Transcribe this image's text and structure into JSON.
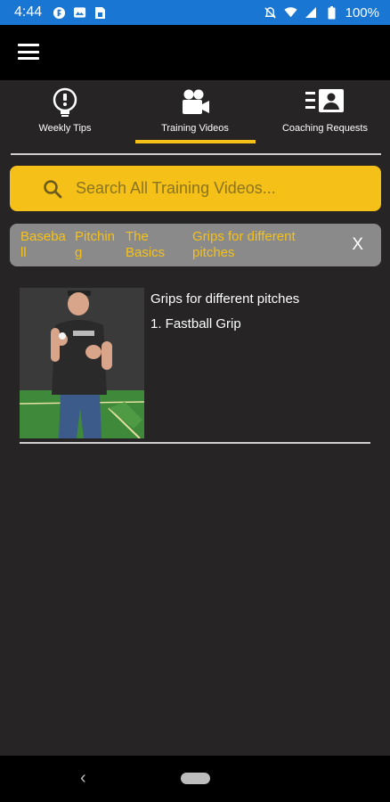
{
  "status_bar": {
    "time": "4:44",
    "battery": "100%",
    "icons_left": [
      "app-notification-icon",
      "photo-icon",
      "sim-icon"
    ],
    "icons_right": [
      "mute-icon",
      "wifi-icon",
      "signal-icon",
      "battery-icon"
    ]
  },
  "app_bar": {
    "menu_icon": "hamburger-menu-icon"
  },
  "tabs": [
    {
      "label": "Weekly Tips",
      "icon": "lightbulb-icon",
      "active": false
    },
    {
      "label": "Training Videos",
      "icon": "video-camera-icon",
      "active": true
    },
    {
      "label": "Coaching Requests",
      "icon": "contact-list-icon",
      "active": false
    }
  ],
  "search": {
    "placeholder": "Search All Training Videos...",
    "value": ""
  },
  "breadcrumb": {
    "items": [
      "Baseball",
      "Pitching",
      "The Basics",
      "Grips for different pitches"
    ],
    "clear_label": "X"
  },
  "videos": [
    {
      "title": "Grips for different pitches",
      "subtitle": "1. Fastball Grip"
    }
  ],
  "nav_bar": {
    "back_label": "‹"
  },
  "colors": {
    "accent": "#f5c118",
    "background": "#262425",
    "status_bar": "#1976d2",
    "filter_bar": "#8a8a8a"
  }
}
